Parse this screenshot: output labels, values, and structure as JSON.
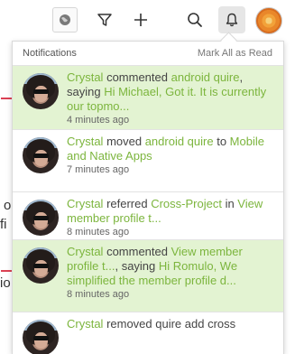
{
  "toolbar": {
    "items": [
      {
        "name": "globe-icon"
      },
      {
        "name": "filter-icon"
      },
      {
        "name": "plus-icon"
      },
      {
        "name": "search-icon"
      },
      {
        "name": "bell-icon"
      },
      {
        "name": "user-avatar"
      }
    ]
  },
  "background": {
    "frag1": "o",
    "frag2": "fi",
    "frag3": "io"
  },
  "panel": {
    "title": "Notifications",
    "mark_all": "Mark All as Read",
    "notifications": [
      {
        "unread": true,
        "actor": "Crystal",
        "parts": [
          {
            "t": " commented ",
            "link": false
          },
          {
            "t": "android quire",
            "link": true
          },
          {
            "t": ", saying ",
            "link": false
          },
          {
            "t": "Hi Michael, Got it. It is currently our topmo...",
            "link": true
          }
        ],
        "time": "4 minutes ago"
      },
      {
        "unread": false,
        "actor": "Crystal",
        "parts": [
          {
            "t": " moved ",
            "link": false
          },
          {
            "t": "android quire",
            "link": true
          },
          {
            "t": " to ",
            "link": false
          },
          {
            "t": "Mobile and Native Apps",
            "link": true
          }
        ],
        "time": "7 minutes ago"
      },
      {
        "unread": false,
        "actor": "Crystal",
        "parts": [
          {
            "t": " referred ",
            "link": false
          },
          {
            "t": "Cross-Project",
            "link": true
          },
          {
            "t": " in ",
            "link": false
          },
          {
            "t": "View member profile t...",
            "link": true
          }
        ],
        "time": "8 minutes ago"
      },
      {
        "unread": true,
        "actor": "Crystal",
        "parts": [
          {
            "t": " commented ",
            "link": false
          },
          {
            "t": "View member profile t...",
            "link": true
          },
          {
            "t": ", saying ",
            "link": false
          },
          {
            "t": "Hi Romulo, We simplified the member profile d...",
            "link": true
          }
        ],
        "time": "8 minutes ago"
      },
      {
        "unread": false,
        "actor": "Crystal",
        "parts": [
          {
            "t": " removed quire add cross",
            "link": false
          }
        ],
        "time": ""
      }
    ]
  },
  "colors": {
    "accent_green": "#7cb53d",
    "unread_bg": "#e3f3d2",
    "arrow_red": "#d0021b"
  }
}
